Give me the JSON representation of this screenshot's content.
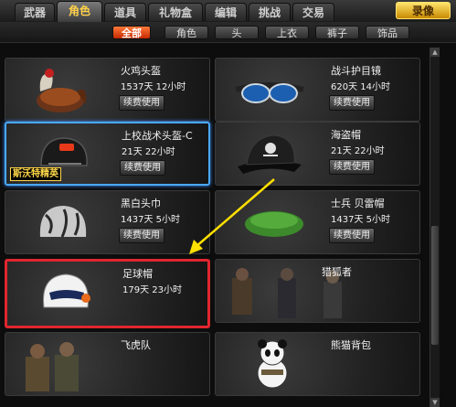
{
  "tabs": [
    {
      "label": "武器",
      "active": false
    },
    {
      "label": "角色",
      "active": true
    },
    {
      "label": "道具",
      "active": false
    },
    {
      "label": "礼物盒",
      "active": false
    },
    {
      "label": "编辑",
      "active": false
    },
    {
      "label": "挑战",
      "active": false
    },
    {
      "label": "交易",
      "active": false
    }
  ],
  "top_button": "录像",
  "filters": [
    {
      "label": "全部",
      "active": true
    },
    {
      "label": "角色",
      "active": false
    },
    {
      "label": "头",
      "active": false
    },
    {
      "label": "上衣",
      "active": false
    },
    {
      "label": "裤子",
      "active": false
    },
    {
      "label": "饰品",
      "active": false
    }
  ],
  "items": [
    {
      "name": "火鸡头盔",
      "time": "1537天 12小时",
      "btn": "续费使用",
      "icon": "turkey-hat-icon"
    },
    {
      "name": "战斗护目镜",
      "time": "620天 14小时",
      "btn": "续费使用",
      "icon": "goggles-icon"
    },
    {
      "name": "上校战术头盔-C",
      "time": "21天 22小时",
      "btn": "续费使用",
      "icon": "tactical-helmet-icon",
      "badge": "斯沃特精英"
    },
    {
      "name": "海盗帽",
      "time": "21天 22小时",
      "btn": "续费使用",
      "icon": "pirate-hat-icon"
    },
    {
      "name": "黑白头巾",
      "time": "1437天 5小时",
      "btn": "续费使用",
      "icon": "bandana-icon"
    },
    {
      "name": "士兵 贝雷帽",
      "time": "1437天 5小时",
      "btn": "续费使用",
      "icon": "beret-icon"
    },
    {
      "name": "足球帽",
      "time": "179天 23小时",
      "btn": "",
      "icon": "football-helmet-icon"
    },
    {
      "name": "猎狐者",
      "time": "",
      "btn": "",
      "icon": "character-group-icon"
    },
    {
      "name": "飞虎队",
      "time": "",
      "btn": "",
      "icon": "soldiers-icon"
    },
    {
      "name": "熊猫背包",
      "time": "",
      "btn": "",
      "icon": "panda-backpack-icon"
    }
  ]
}
